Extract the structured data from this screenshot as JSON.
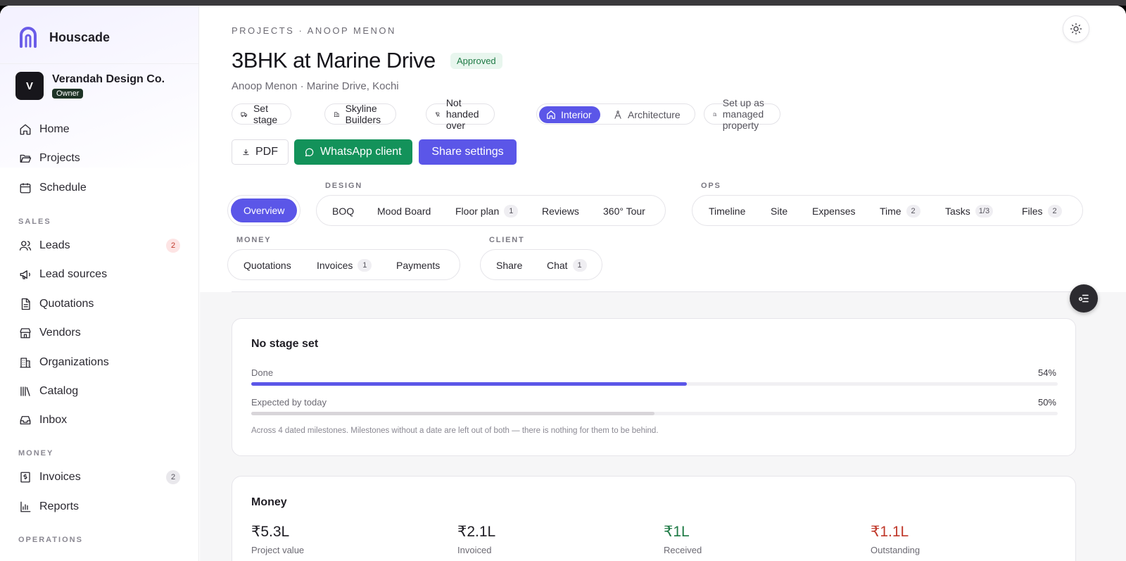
{
  "app": {
    "name": "Houscade"
  },
  "org": {
    "initial": "V",
    "name": "Verandah Design Co.",
    "role": "Owner"
  },
  "nav": {
    "home": "Home",
    "projects": "Projects",
    "schedule": "Schedule",
    "sales_section": "SALES",
    "leads": "Leads",
    "leads_count": "2",
    "lead_sources": "Lead sources",
    "quotations": "Quotations",
    "vendors": "Vendors",
    "organizations": "Organizations",
    "catalog": "Catalog",
    "inbox": "Inbox",
    "money_section": "MONEY",
    "invoices": "Invoices",
    "invoices_count": "2",
    "reports": "Reports",
    "operations_section": "OPERATIONS"
  },
  "header": {
    "breadcrumb": "PROJECTS · ANOOP MENON",
    "title": "3BHK at Marine Drive",
    "status": "Approved",
    "subtitle": "Anoop Menon · Marine Drive, Kochi"
  },
  "chips": {
    "set_stage": "Set stage",
    "builder": "Skyline Builders",
    "handover": "Not handed over",
    "type_interior": "Interior",
    "type_architecture": "Architecture",
    "managed": "Set up as managed property"
  },
  "actions": {
    "pdf": "PDF",
    "whatsapp": "WhatsApp client",
    "share": "Share settings"
  },
  "tabs": {
    "overview": "Overview",
    "design_label": "DESIGN",
    "boq": "BOQ",
    "mood_board": "Mood Board",
    "floor_plan": "Floor plan",
    "floor_plan_count": "1",
    "reviews": "Reviews",
    "tour": "360° Tour",
    "ops_label": "OPS",
    "timeline": "Timeline",
    "site": "Site",
    "expenses": "Expenses",
    "time": "Time",
    "time_count": "2",
    "tasks": "Tasks",
    "tasks_count": "1/3",
    "files": "Files",
    "files_count": "2",
    "money_label": "MONEY",
    "quotations": "Quotations",
    "invoices": "Invoices",
    "invoices_count": "1",
    "payments": "Payments",
    "client_label": "CLIENT",
    "share": "Share",
    "chat": "Chat",
    "chat_count": "1"
  },
  "stage_card": {
    "title": "No stage set",
    "done_label": "Done",
    "done_value": "54%",
    "done_fraction": 0.54,
    "expected_label": "Expected by today",
    "expected_value": "50%",
    "expected_fraction": 0.5,
    "note": "Across 4 dated milestones. Milestones without a date are left out of both — there is nothing for them to be behind."
  },
  "money_card": {
    "title": "Money",
    "items": [
      {
        "value": "₹5.3L",
        "label": "Project value",
        "color": "#1f1d24"
      },
      {
        "value": "₹2.1L",
        "label": "Invoiced",
        "color": "#1f1d24"
      },
      {
        "value": "₹1L",
        "label": "Received",
        "color": "#1e7a45"
      },
      {
        "value": "₹1.1L",
        "label": "Outstanding",
        "color": "#c0392b"
      }
    ]
  },
  "colors": {
    "accent": "#5b56e8",
    "whatsapp": "#13925a",
    "progress_done": "#5b56e8",
    "progress_expected": "#d8d5d9"
  }
}
